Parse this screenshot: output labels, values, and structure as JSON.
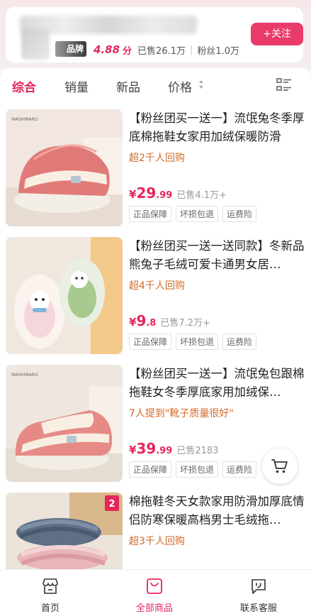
{
  "store": {
    "brand_badge": "品牌",
    "rating": "4.88",
    "rating_unit": "分",
    "sold": "已售26.1万",
    "fans": "粉丝1.0万",
    "follow_label": "+关注"
  },
  "filters": {
    "tabs": [
      "综合",
      "销量",
      "新品",
      "价格"
    ],
    "active_index": 0
  },
  "products": [
    {
      "title": "【粉丝团买一送一】流氓兔冬季厚底棉拖鞋女家用加绒保暖防滑",
      "sub": "超2千人回购",
      "yen": "¥",
      "price_int": "29",
      "price_dec": ".99",
      "sold": "已售4.1万+",
      "tags": [
        "正品保障",
        "坏损包退",
        "运费险"
      ],
      "image": "pink-striped-slipper",
      "image_label": "MASHIMARO"
    },
    {
      "title": "【粉丝团买一送一送同款】冬新品熊兔子毛绒可爱卡通男女居…",
      "sub": "超4千人回购",
      "yen": "¥",
      "price_int": "9",
      "price_dec": ".8",
      "sold": "已售7.2万+",
      "tags": [
        "正品保障",
        "坏损包退",
        "运费险"
      ],
      "image": "plush-bunny-slippers"
    },
    {
      "title": "【粉丝团买一送一】流氓兔包跟棉拖鞋女冬季厚底家用加绒保…",
      "sub": "7人提到\"靴子质量很好\"",
      "yen": "¥",
      "price_int": "39",
      "price_dec": ".99",
      "sold": "已售2183",
      "tags": [
        "正品保障",
        "坏损包退",
        "运费险"
      ],
      "image": "pink-closed-back-slipper",
      "image_label": "MASHIMARO"
    },
    {
      "title": "棉拖鞋冬天女款家用防滑加厚底情侣防寒保暖高档男士毛绒拖…",
      "sub": "超3千人回购",
      "image": "couple-striped-slippers",
      "image_badge": "2"
    }
  ],
  "nav": [
    {
      "label": "首页",
      "icon": "store-icon"
    },
    {
      "label": "全部商品",
      "icon": "bag-icon"
    },
    {
      "label": "联系客服",
      "icon": "chat-icon"
    }
  ],
  "colors": {
    "accent": "#e4275a",
    "follow_bg": "#e83b6a",
    "sub_text": "#d26a2a"
  }
}
